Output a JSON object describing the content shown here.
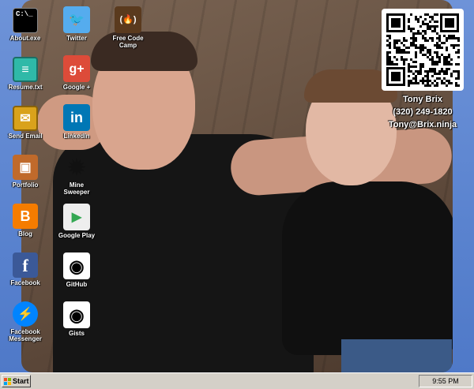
{
  "desktop": {
    "icons": [
      {
        "name": "about-exe-icon",
        "label": "About.exe",
        "glyph": "C:\\_",
        "bg": "#000000",
        "fg": "#ffffff"
      },
      {
        "name": "resume-txt-icon",
        "label": "Resume.txt",
        "glyph": "≡",
        "bg": "#2fb9a8",
        "fg": "#ffffff"
      },
      {
        "name": "send-email-icon",
        "label": "Send Email",
        "glyph": "✉",
        "bg": "#d9a21b",
        "fg": "#ffffff"
      },
      {
        "name": "portfolio-icon",
        "label": "Portfolio",
        "glyph": "▣",
        "bg": "#c06a2b",
        "fg": "#ffffff"
      },
      {
        "name": "blog-icon",
        "label": "Blog",
        "glyph": "B",
        "bg": "#f57c00",
        "fg": "#ffffff"
      },
      {
        "name": "facebook-icon",
        "label": "Facebook",
        "glyph": "f",
        "bg": "#3b5998",
        "fg": "#ffffff"
      },
      {
        "name": "facebook-messenger-icon",
        "label": "Facebook Messenger",
        "glyph": "⚡",
        "bg": "#0084ff",
        "fg": "#ffffff"
      },
      {
        "name": "twitter-icon",
        "label": "Twitter",
        "glyph": "🐦",
        "bg": "#55acee",
        "fg": "#ffffff"
      },
      {
        "name": "google-plus-icon",
        "label": "Google +",
        "glyph": "g+",
        "bg": "#dd4b39",
        "fg": "#ffffff"
      },
      {
        "name": "linkedin-icon",
        "label": "LinkedIn",
        "glyph": "in",
        "bg": "#0077b5",
        "fg": "#ffffff"
      },
      {
        "name": "mine-sweeper-icon",
        "label": "Mine Sweeper",
        "glyph": "✹",
        "bg": "#6b6b6b",
        "fg": "#000000"
      },
      {
        "name": "google-play-icon",
        "label": "Google Play",
        "glyph": "▶",
        "bg": "#e8e8e8",
        "fg": "#34a853"
      },
      {
        "name": "github-icon",
        "label": "GitHub",
        "glyph": "◉",
        "bg": "#ffffff",
        "fg": "#000000"
      },
      {
        "name": "gists-icon",
        "label": "Gists",
        "glyph": "◉",
        "bg": "#ffffff",
        "fg": "#000000"
      },
      {
        "name": "free-code-camp-icon",
        "label": "Free Code Camp",
        "glyph": "(🔥)",
        "bg": "#5a3a1e",
        "fg": "#ffffff"
      }
    ]
  },
  "contact": {
    "name": "Tony Brix",
    "phone": "(320) 249-1820",
    "email": "Tony@Brix.ninja"
  },
  "taskbar": {
    "start_label": "Start",
    "clock": "9:55 PM"
  }
}
